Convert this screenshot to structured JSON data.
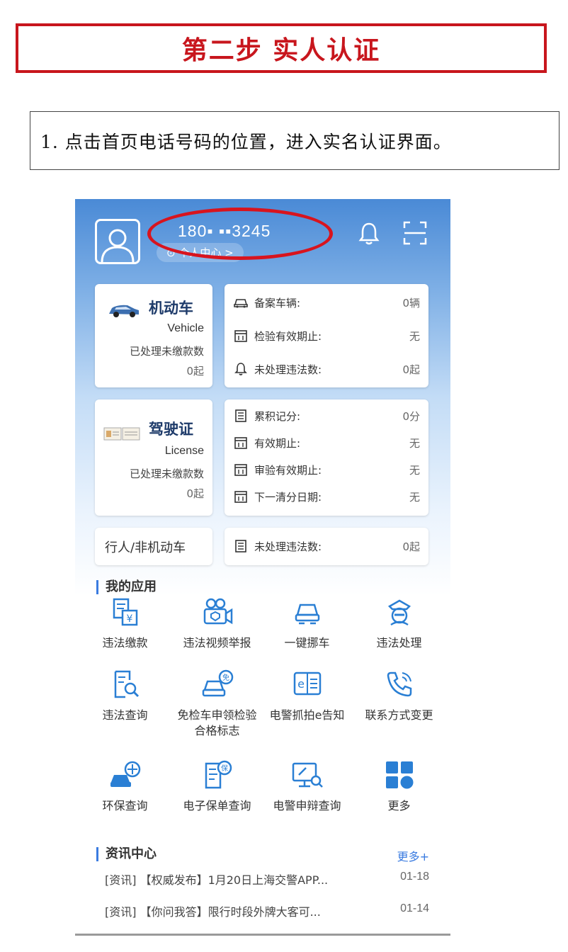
{
  "banner": {
    "title": "第二步  实人认证"
  },
  "instruction": {
    "text": "1. 点击首页电话号码的位置，进入实名认证界面。"
  },
  "header": {
    "phone": "180▪ ▪▪3245",
    "personal_center": "⊙ 个人中心 >"
  },
  "vehicle_card": {
    "title": "机动车",
    "title_en": "Vehicle",
    "sub": "已处理未缴款数",
    "count": "0起",
    "rows": [
      {
        "label": "备案车辆:",
        "value": "0辆",
        "icon": "car-outline-icon"
      },
      {
        "label": "检验有效期止:",
        "value": "无",
        "icon": "calendar-icon"
      },
      {
        "label": "未处理违法数:",
        "value": "0起",
        "icon": "bell-icon"
      }
    ]
  },
  "license_card": {
    "title": "驾驶证",
    "title_en": "License",
    "sub": "已处理未缴款数",
    "count": "0起",
    "rows": [
      {
        "label": "累积记分:",
        "value": "0分",
        "icon": "list-icon"
      },
      {
        "label": "有效期止:",
        "value": "无",
        "icon": "calendar-icon"
      },
      {
        "label": "审验有效期止:",
        "value": "无",
        "icon": "calendar-icon"
      },
      {
        "label": "下一清分日期:",
        "value": "无",
        "icon": "calendar-icon"
      }
    ]
  },
  "pedestrian": {
    "title": "行人/非机动车",
    "row_label": "未处理违法数:",
    "row_value": "0起"
  },
  "my_apps": {
    "title": "我的应用",
    "items": [
      {
        "label": "违法缴款",
        "icon": "payment-icon"
      },
      {
        "label": "违法视频举报",
        "icon": "video-report-icon"
      },
      {
        "label": "一键挪车",
        "icon": "move-car-icon"
      },
      {
        "label": "违法处理",
        "icon": "police-icon"
      },
      {
        "label": "违法查询",
        "icon": "search-doc-icon"
      },
      {
        "label": "免检车申领检验合格标志",
        "icon": "exempt-car-icon"
      },
      {
        "label": "电警抓拍e告知",
        "icon": "e-notice-icon"
      },
      {
        "label": "联系方式变更",
        "icon": "phone-icon"
      },
      {
        "label": "环保查询",
        "icon": "eco-car-icon"
      },
      {
        "label": "电子保单查询",
        "icon": "insurance-icon"
      },
      {
        "label": "电警申辩查询",
        "icon": "appeal-search-icon"
      },
      {
        "label": "更多",
        "icon": "grid-more-icon"
      }
    ]
  },
  "news": {
    "title": "资讯中心",
    "more": "更多+",
    "items": [
      {
        "text": "[资讯] 【权威发布】1月20日上海交警APP...",
        "date": "01-18"
      },
      {
        "text": "[资讯] 【你问我答】限行时段外牌大客可...",
        "date": "01-14"
      }
    ]
  },
  "colors": {
    "banner_red": "#c8161d",
    "accent_blue": "#3a7be0",
    "header_blue": "#4a8ad6",
    "highlight_red": "#d8141e"
  }
}
